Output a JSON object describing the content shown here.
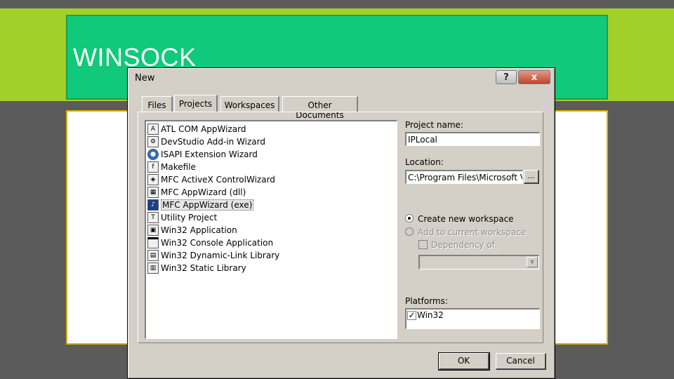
{
  "slide": {
    "title": "WINSOCK",
    "colors": {
      "background": "#5b5b5b",
      "band": "#a3cf2a",
      "title_box": "#10c97a",
      "content_border": "#d8b000"
    }
  },
  "dialog": {
    "title": "New",
    "help_icon": "?",
    "close_icon": "x",
    "tabs": [
      {
        "label": "Files"
      },
      {
        "label": "Projects",
        "active": true
      },
      {
        "label": "Workspaces"
      },
      {
        "label": "Other Documents"
      }
    ],
    "project_types": [
      {
        "label": "ATL COM AppWizard",
        "icon": "atl-icon"
      },
      {
        "label": "DevStudio Add-in Wizard",
        "icon": "addin-icon"
      },
      {
        "label": "ISAPI Extension Wizard",
        "icon": "globe-icon"
      },
      {
        "label": "Makefile",
        "icon": "makefile-icon"
      },
      {
        "label": "MFC ActiveX ControlWizard",
        "icon": "activex-icon"
      },
      {
        "label": "MFC AppWizard (dll)",
        "icon": "mfc-dll-icon"
      },
      {
        "label": "MFC AppWizard (exe)",
        "icon": "mfc-exe-icon",
        "selected": true
      },
      {
        "label": "Utility Project",
        "icon": "utility-icon"
      },
      {
        "label": "Win32 Application",
        "icon": "win32-app-icon"
      },
      {
        "label": "Win32 Console Application",
        "icon": "console-icon"
      },
      {
        "label": "Win32 Dynamic-Link Library",
        "icon": "dll-icon"
      },
      {
        "label": "Win32 Static Library",
        "icon": "lib-icon"
      }
    ],
    "project_name_label": "Project name:",
    "project_name_value": "IPLocal",
    "location_label": "Location:",
    "location_value": "C:\\Program Files\\Microsoft Visua",
    "browse_label": "...",
    "radio_create": "Create new workspace",
    "radio_add": "Add to current workspace",
    "dependency_label": "Dependency of:",
    "platforms_label": "Platforms:",
    "platform_item": "Win32",
    "ok_label": "OK",
    "cancel_label": "Cancel"
  }
}
